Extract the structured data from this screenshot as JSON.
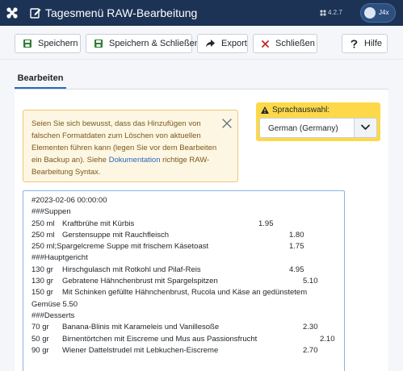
{
  "header": {
    "title": "Tagesmenü RAW-Bearbeitung",
    "version": "4.2.7",
    "j4x_label": "J4x"
  },
  "toolbar": {
    "save": "Speichern",
    "save_close": "Speichern & Schließen",
    "export": "Export",
    "close": "Schließen",
    "help": "Hilfe"
  },
  "tabs": {
    "edit": "Bearbeiten"
  },
  "alert": {
    "text_before": "Seien Sie sich bewusst, dass das Hinzufügen von falschen Formatdaten zum Löschen von aktuellen Elementen führen kann (legen Sie vor dem Bearbeiten ein Backup an). Siehe ",
    "link": "Dokumentation",
    "text_after": " richtige RAW-Bearbeitung Syntax."
  },
  "language": {
    "label": "Sprachauswahl:",
    "selected": "German (Germany)"
  },
  "editor_lines": [
    {
      "text": "#2023-02-06 00:00:00"
    },
    {
      "text": "###Suppen"
    },
    {
      "qty": "250 ml",
      "item": "Kraftbrühe mit Kürbis",
      "price": "1.95",
      "col": "a"
    },
    {
      "qty": "250 ml",
      "item": "Gerstensuppe mit Rauchfleisch",
      "price": "1.80",
      "col": "b"
    },
    {
      "text": "250 ml;Spargelcreme Suppe mit frischem Käsetoast",
      "price": "1.75",
      "col": "b"
    },
    {
      "text": "###Hauptgericht"
    },
    {
      "qty": "130 gr",
      "item": "Hirschgulasch mit Rotkohl und Pilaf-Reis",
      "price": "4.95",
      "col": "b"
    },
    {
      "qty": "130 gr",
      "item": "Gebratene Hähnchenbrust mit Spargelspitzen",
      "price": "5.10",
      "col": "c"
    },
    {
      "qty": "150 gr",
      "item": "Mit Schinken gefüllte Hähnchenbrust, Rucola und Käse an gedünstetem"
    },
    {
      "text": "Gemüse 5.50"
    },
    {
      "text": "###Desserts"
    },
    {
      "qty": "70 gr",
      "item": "Banana-Blinis mit Karameleis und Vanillesoße",
      "price": "2.30",
      "col": "d"
    },
    {
      "qty": "50 gr",
      "item": "Birnentörtchen mit Eiscreme und Mus aus Passionsfrucht",
      "price": "2.10",
      "col": "e"
    },
    {
      "qty": "90 gr",
      "item": "Wiener Dattelstrudel mit Lebkuchen-Eiscreme",
      "price": "2.70",
      "col": "d"
    }
  ],
  "icons": {
    "logo": "joomla-logo",
    "title": "edit-icon",
    "save": "floppy-disk-icon",
    "save_close": "floppy-disk-icon",
    "export": "share-arrow-icon",
    "close": "times-icon",
    "help": "question-icon",
    "alert_close": "close-icon",
    "language": "warning-triangle-icon",
    "dropdown": "chevron-down-icon"
  },
  "colors": {
    "header_bg": "#1c3355",
    "accent_blue": "#2a69b8",
    "alert_bg": "#fdf6e3",
    "alert_border": "#f0c674",
    "alert_text": "#7a5a1a",
    "language_bg": "#fdd94a",
    "close_red": "#c52827",
    "save_green": "#2f7d32"
  }
}
